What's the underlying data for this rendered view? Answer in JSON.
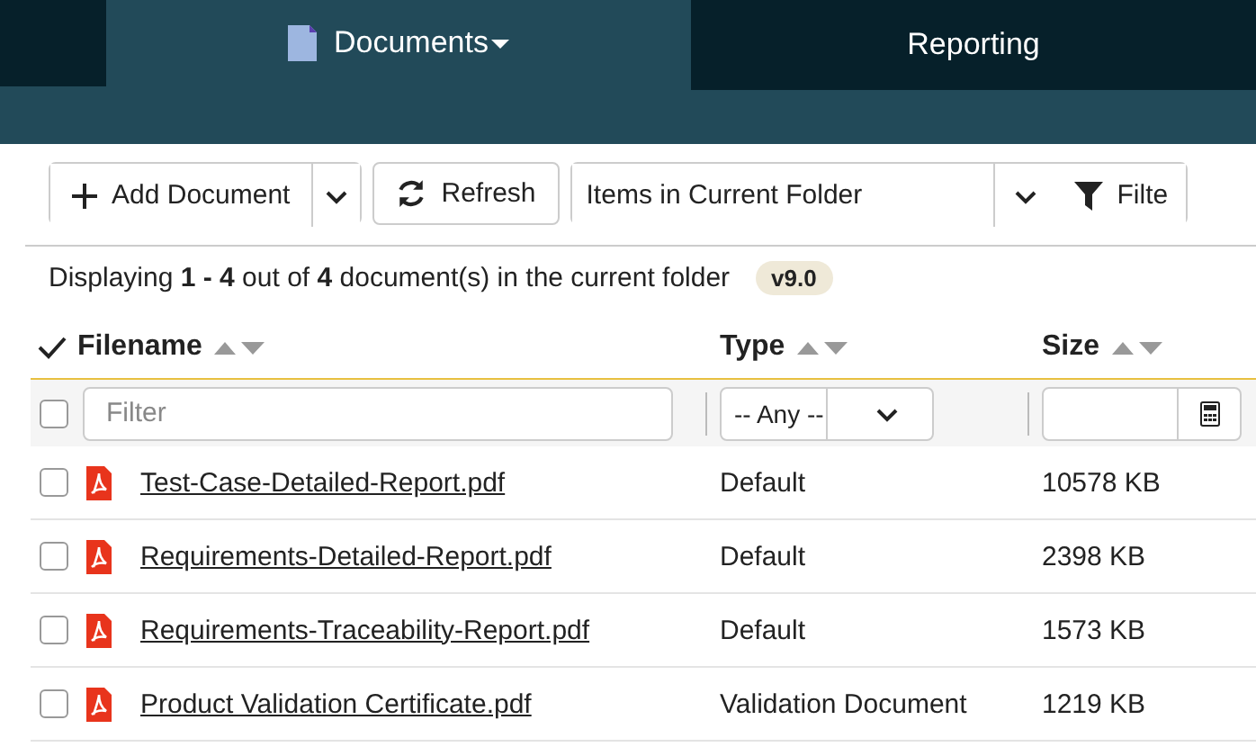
{
  "nav": {
    "tabs": [
      {
        "label": "Documents",
        "selected": true,
        "dropdown": true
      },
      {
        "label": "Reporting",
        "selected": false,
        "dropdown": false
      }
    ]
  },
  "toolbar": {
    "add_button": "Add Document",
    "refresh_button": "Refresh",
    "view_select": "Items in Current Folder",
    "filter_button": "Filte"
  },
  "status": {
    "text": "Displaying **1 - 4** out of **4** document(s) in the current folder",
    "version": "v9.0"
  },
  "table": {
    "columns": [
      "Filename",
      "Type",
      "Size"
    ],
    "filters": {
      "filename_placeholder": "Filter",
      "type_value": "-- Any --",
      "select_all_checked": false
    },
    "rows": [
      {
        "filename": "Test-Case-Detailed-Report.pdf",
        "type": "Default",
        "size": "10578 KB",
        "checked": false
      },
      {
        "filename": "Requirements-Detailed-Report.pdf",
        "type": "Default",
        "size": "2398 KB",
        "checked": false
      },
      {
        "filename": "Requirements-Traceability-Report.pdf",
        "type": "Default",
        "size": "1573 KB",
        "checked": false
      },
      {
        "filename": "Product Validation Certificate.pdf",
        "type": "Validation Document",
        "size": "1219 KB",
        "checked": false
      }
    ]
  }
}
